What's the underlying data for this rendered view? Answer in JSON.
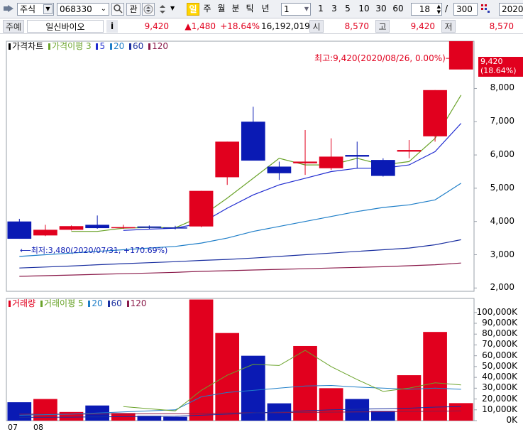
{
  "toolbar": {
    "market": "주식",
    "code": "068330",
    "btn_fav": "관",
    "periods": [
      "일",
      "주",
      "월",
      "분",
      "틱",
      "년"
    ],
    "interval_value": "1",
    "ranges": [
      "1",
      "3",
      "5",
      "10",
      "30",
      "60"
    ],
    "count_value": "18",
    "slash": "/",
    "total_value": "300",
    "date_value": "2020/"
  },
  "quote": {
    "tag": "주예",
    "name": "일신바이오",
    "info_icon": "i",
    "price": "9,420",
    "change": "▲1,480",
    "change_pct": "+18.64%",
    "volume": "16,192,019",
    "open_label": "시",
    "open": "8,570",
    "high_label": "고",
    "high": "9,420",
    "low_label": "저",
    "low": "8,570"
  },
  "price_panel": {
    "legend_title": "가격차트",
    "legend_ma": "가격이평",
    "legend_periods": [
      "3",
      "5",
      "20",
      "60",
      "120"
    ],
    "high_annotation": "최고:9,420(2020/08/26, 0.00%)⟶",
    "low_annotation": "⟵최저:3,480(2020/07/31, +170.69%)",
    "current_price_tag": "9,420",
    "current_pct_tag": "(18.64%)",
    "axis_labels": [
      "8,000",
      "7,000",
      "6,000",
      "5,000",
      "4,000",
      "3,000",
      "2,000"
    ]
  },
  "volume_panel": {
    "legend_title": "거래량",
    "legend_ma": "거래이평",
    "legend_periods": [
      "5",
      "20",
      "60",
      "120"
    ],
    "axis_labels": [
      "100,000K",
      "90,000K",
      "80,000K",
      "70,000K",
      "60,000K",
      "50,000K",
      "40,000K",
      "30,000K",
      "20,000K",
      "10,000K",
      "0K"
    ]
  },
  "x_axis": {
    "labels": [
      "07",
      "08"
    ]
  },
  "colors": {
    "up": "#e1001e",
    "down": "#0a1ab4",
    "ma3": "#6aa32a",
    "ma5": "#1f2bd0",
    "ma20": "#1e7ec8",
    "ma60": "#1a2fa0",
    "ma120": "#8a1a4a"
  },
  "chart_data": {
    "type": "candlestick",
    "candles": [
      {
        "o": 4000,
        "h": 4080,
        "l": 3480,
        "c": 3480
      },
      {
        "o": 3580,
        "h": 3900,
        "l": 3560,
        "c": 3750
      },
      {
        "o": 3750,
        "h": 3880,
        "l": 3730,
        "c": 3860
      },
      {
        "o": 3900,
        "h": 4180,
        "l": 3780,
        "c": 3800
      },
      {
        "o": 3820,
        "h": 3900,
        "l": 3780,
        "c": 3830
      },
      {
        "o": 3850,
        "h": 3880,
        "l": 3780,
        "c": 3810
      },
      {
        "o": 3820,
        "h": 3870,
        "l": 3760,
        "c": 3790
      },
      {
        "o": 3850,
        "h": 4920,
        "l": 3830,
        "c": 4920
      },
      {
        "o": 5330,
        "h": 6400,
        "l": 5100,
        "c": 6400
      },
      {
        "o": 7000,
        "h": 7450,
        "l": 5900,
        "c": 5830
      },
      {
        "o": 5650,
        "h": 5800,
        "l": 5250,
        "c": 5450
      },
      {
        "o": 5750,
        "h": 6750,
        "l": 5400,
        "c": 5800
      },
      {
        "o": 5600,
        "h": 6500,
        "l": 5550,
        "c": 5950
      },
      {
        "o": 6000,
        "h": 6400,
        "l": 5600,
        "c": 5950
      },
      {
        "o": 5850,
        "h": 5900,
        "l": 5350,
        "c": 5370
      },
      {
        "o": 6100,
        "h": 6450,
        "l": 5900,
        "c": 6150
      },
      {
        "o": 6560,
        "h": 7950,
        "l": 6400,
        "c": 7950
      },
      {
        "o": 8570,
        "h": 9420,
        "l": 8570,
        "c": 9420
      }
    ],
    "ma": {
      "3": [
        null,
        null,
        3700,
        3700,
        3800,
        3820,
        3810,
        4150,
        4700,
        5300,
        5900,
        5700,
        5700,
        5900,
        5700,
        5800,
        6500,
        7800
      ],
      "5": [
        null,
        null,
        null,
        null,
        3730,
        3770,
        3800,
        3950,
        4400,
        4800,
        5100,
        5300,
        5500,
        5600,
        5600,
        5700,
        6100,
        6950
      ],
      "20": [
        2950,
        3000,
        3050,
        3100,
        3150,
        3200,
        3250,
        3350,
        3500,
        3700,
        3850,
        4000,
        4150,
        4300,
        4420,
        4500,
        4650,
        5150
      ],
      "60": [
        2600,
        2630,
        2660,
        2700,
        2730,
        2760,
        2790,
        2830,
        2860,
        2900,
        2950,
        3000,
        3050,
        3100,
        3150,
        3200,
        3300,
        3450
      ],
      "120": [
        2350,
        2370,
        2390,
        2410,
        2430,
        2450,
        2470,
        2500,
        2520,
        2540,
        2560,
        2580,
        2600,
        2620,
        2640,
        2670,
        2700,
        2750
      ]
    },
    "volume": [
      17000,
      20000,
      8000,
      14000,
      7000,
      4500,
      3500,
      112000,
      81000,
      60000,
      16000,
      69000,
      30000,
      20000,
      9000,
      42000,
      82000,
      16192
    ],
    "vol_ma": {
      "5": [
        null,
        null,
        null,
        null,
        13000,
        11000,
        9000,
        28000,
        42000,
        52000,
        51000,
        65000,
        50000,
        38000,
        27000,
        30000,
        35000,
        33000
      ],
      "20": [
        5000,
        5500,
        6000,
        7000,
        8000,
        9000,
        10000,
        22000,
        26000,
        28000,
        30000,
        32000,
        32500,
        31000,
        30000,
        29000,
        30000,
        29000
      ],
      "60": [
        3000,
        3100,
        3200,
        3500,
        3700,
        3900,
        4100,
        5000,
        6000,
        7000,
        8000,
        9000,
        10000,
        10500,
        11000,
        11500,
        12500,
        13000
      ],
      "120": [
        6000,
        6000,
        6000,
        6100,
        6200,
        6300,
        6400,
        6700,
        7000,
        7200,
        7400,
        7600,
        7800,
        8000,
        8200,
        8400,
        8700,
        9000
      ]
    },
    "ylim_price": [
      1900,
      9420
    ],
    "ylim_volume": [
      0,
      113000
    ]
  }
}
